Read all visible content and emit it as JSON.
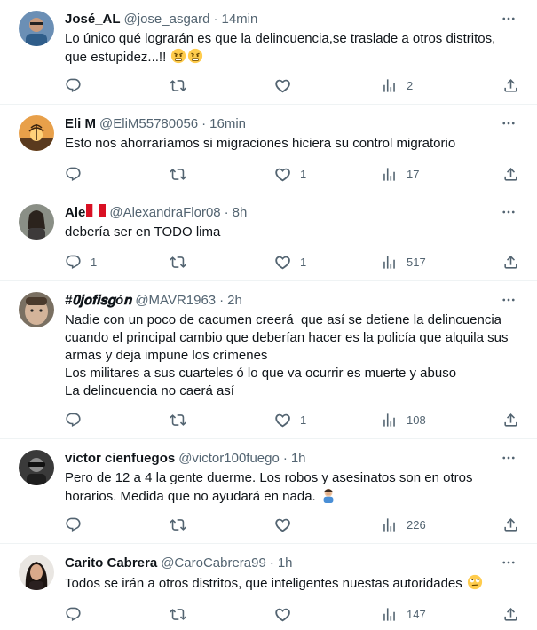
{
  "tweets": [
    {
      "name": "José_AL",
      "handle": "@jose_asgard",
      "time": "14min",
      "text": "Lo único qué lograrán es que la delincuencia,se traslade a otros distritos, que estupidez...!! ",
      "replies": "",
      "retweets": "",
      "likes": "",
      "views": "2"
    },
    {
      "name": "Eli M",
      "handle": "@EliM55780056",
      "time": "16min",
      "text": "Esto nos ahorraríamos si migraciones hiciera su control migratorio",
      "replies": "",
      "retweets": "",
      "likes": "1",
      "views": "17"
    },
    {
      "name": "Ale",
      "handle": "@AlexandraFlor08",
      "time": "8h",
      "text": "debería ser en TODO lima",
      "replies": "1",
      "retweets": "",
      "likes": "1",
      "views": "517"
    },
    {
      "name": "#𝟎𝐣𝐨𝐟𝐢𝐬𝐠ó𝐧",
      "handle": "@MAVR1963",
      "time": "2h",
      "text": "Nadie con un poco de cacumen creerá  que así se detiene la delincuencia cuando el principal cambio que deberían hacer es la policía que alquila sus armas y deja impune los crímenes\nLos militares a sus cuarteles ó lo que va ocurrir es muerte y abuso\nLa delincuencia no caerá así",
      "replies": "",
      "retweets": "",
      "likes": "1",
      "views": "108"
    },
    {
      "name": "victor cienfuegos",
      "handle": "@victor100fuego",
      "time": "1h",
      "text": "Pero de 12 a 4 la gente duerme. Los robos y asesinatos son en otros horarios. Medida que no ayudará en nada. ",
      "replies": "",
      "retweets": "",
      "likes": "",
      "views": "226"
    },
    {
      "name": "Carito Cabrera",
      "handle": "@CaroCabrera99",
      "time": "1h",
      "text": "Todos se irán a otros distritos, que inteligentes nuestas autoridades ",
      "replies": "",
      "retweets": "",
      "likes": "",
      "views": "147"
    }
  ],
  "separator": "·",
  "icons": {
    "more": "more-icon",
    "reply": "reply-icon",
    "retweet": "retweet-icon",
    "like": "like-icon",
    "views": "views-icon",
    "share": "share-icon"
  },
  "colors": {
    "text": "#0f1419",
    "secondary": "#536471",
    "divider": "#eff3f4",
    "flag_red": "#d91023"
  }
}
